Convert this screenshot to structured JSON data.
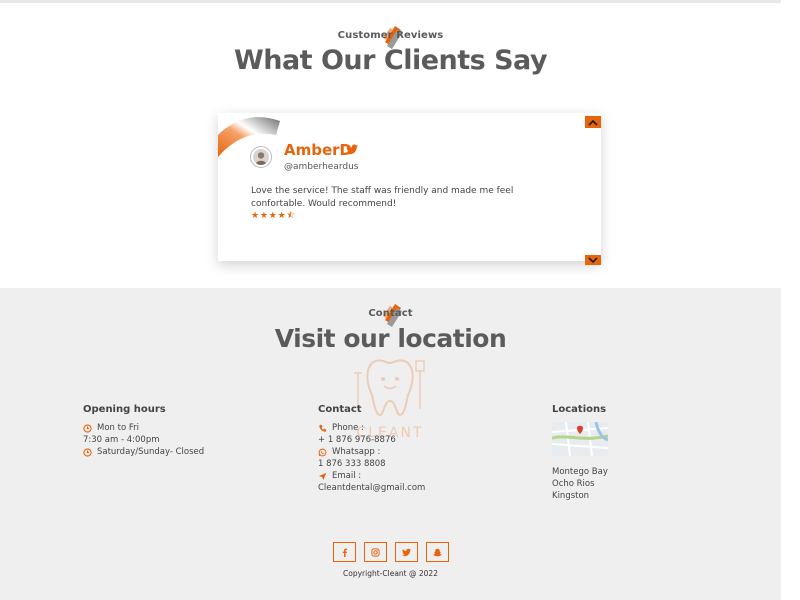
{
  "reviews": {
    "badge_label": "Customer Reviews",
    "title": "What Our Clients Say",
    "card": {
      "name": "AmberD",
      "handle": "@amberheardus",
      "text": "Love the service! The staff was friendly and made me feel confortable. Would recommend!",
      "stars": "★★★★⯪",
      "rating": 4.5
    }
  },
  "contact": {
    "badge_label": "Contact",
    "title": "Visit our location",
    "hours": {
      "title": "Opening hours",
      "line1": "Mon to Fri",
      "line2": "7:30 am - 4:00pm",
      "line3": "Saturday/Sunday- Closed"
    },
    "info": {
      "title": "Contact",
      "phone_label": "Phone :",
      "phone": "+ 1 876 976-8876",
      "whatsapp_label": "Whatsapp :",
      "whatsapp": "1 876 333 8808",
      "email_label": "Email :",
      "email": "Cleantdental@gmail.com"
    },
    "locations": {
      "title": "Locations",
      "items": [
        "Montego Bay",
        "Ocho Rios",
        "Kingston"
      ]
    },
    "watermark_text": "CLEANT"
  },
  "footer": {
    "copyright": "Copyright-Cleant @ 2022",
    "social_icons": [
      "facebook-icon",
      "instagram-icon",
      "twitter-icon",
      "snapchat-icon"
    ]
  },
  "colors": {
    "accent": "#e8640c",
    "heading": "#5b5b5b",
    "contact_bg": "#efefef"
  }
}
